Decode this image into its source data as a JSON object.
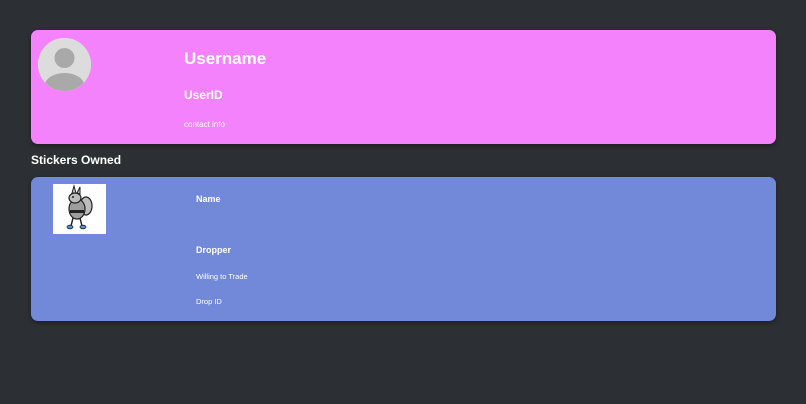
{
  "profile": {
    "avatar_icon": "default-user-avatar-icon",
    "username": "Username",
    "user_id": "UserID",
    "contact": "contact info",
    "background_color": "#f482fc"
  },
  "stickers_section": {
    "title": "Stickers Owned"
  },
  "stickers": [
    {
      "image_icon": "cartoon-sticker-image",
      "name_label": "Name",
      "dropper_label": "Dropper",
      "trade_label": "Willing to Trade",
      "drop_id_label": "Drop ID",
      "background_color": "#7289da"
    }
  ],
  "page_background": "#2c2f33"
}
